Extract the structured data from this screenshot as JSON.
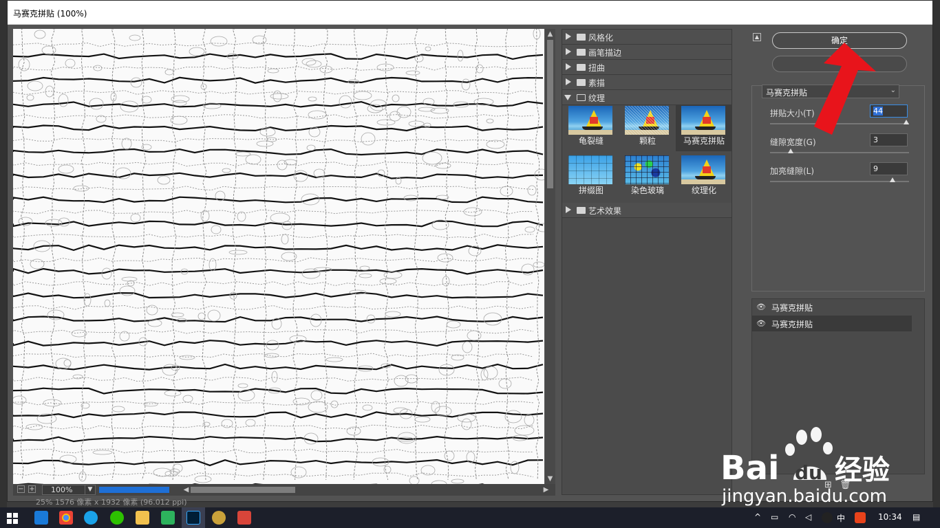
{
  "dialog": {
    "title": "马赛克拼贴 (100%)"
  },
  "preview": {
    "zoom": "100%",
    "status": "25%   1576 像素 x 1932 像素 (96.012 ppi)"
  },
  "gallery": {
    "categories": [
      {
        "label": "风格化",
        "open": false
      },
      {
        "label": "画笔描边",
        "open": false
      },
      {
        "label": "扭曲",
        "open": false
      },
      {
        "label": "素描",
        "open": false
      },
      {
        "label": "纹理",
        "open": true
      },
      {
        "label": "艺术效果",
        "open": false
      }
    ],
    "texture_filters": [
      {
        "label": "龟裂缝",
        "selected": false
      },
      {
        "label": "颗粒",
        "selected": false
      },
      {
        "label": "马赛克拼贴",
        "selected": true
      },
      {
        "label": "拼缀图",
        "selected": false
      },
      {
        "label": "染色玻璃",
        "selected": false
      },
      {
        "label": "纹理化",
        "selected": false
      }
    ]
  },
  "settings": {
    "ok_label": "确定",
    "cancel_label": "",
    "filter_select": "马赛克拼贴",
    "params": [
      {
        "label": "拼贴大小(T)",
        "value": "44",
        "level": 1.0
      },
      {
        "label": "缝隙宽度(G)",
        "value": "3",
        "level": 0.15
      },
      {
        "label": "加亮缝隙(L)",
        "value": "9",
        "level": 0.9
      }
    ]
  },
  "layers": [
    {
      "label": "马赛克拼贴",
      "selected": false
    },
    {
      "label": "马赛克拼贴",
      "selected": true
    }
  ],
  "taskbar": {
    "ime": "中",
    "time": "10:34"
  },
  "watermark": {
    "brand": "Bai",
    "brand2": "du",
    "brand3": "经验",
    "url": "jingyan.baidu.com"
  },
  "colors": {
    "accent": "#1e6fd6",
    "arrow": "#e8141b",
    "watermark": "#ffffff"
  }
}
